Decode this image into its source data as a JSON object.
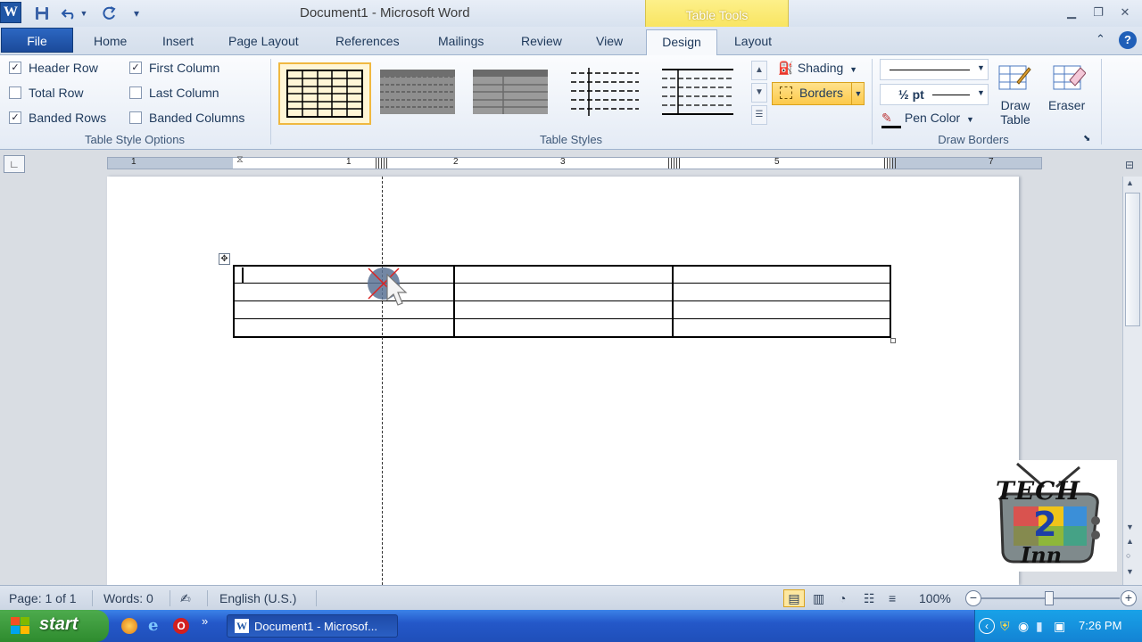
{
  "window": {
    "title": "Document1 - Microsoft Word",
    "contextual_tab_group": "Table Tools"
  },
  "tabs": [
    "File",
    "Home",
    "Insert",
    "Page Layout",
    "References",
    "Mailings",
    "Review",
    "View",
    "Design",
    "Layout"
  ],
  "active_tab": "Design",
  "ribbon": {
    "table_style_options": {
      "label": "Table Style Options",
      "options": [
        {
          "label": "Header Row",
          "checked": true
        },
        {
          "label": "Total Row",
          "checked": false
        },
        {
          "label": "Banded Rows",
          "checked": true
        },
        {
          "label": "First Column",
          "checked": true
        },
        {
          "label": "Last Column",
          "checked": false
        },
        {
          "label": "Banded Columns",
          "checked": false
        }
      ]
    },
    "table_styles": {
      "label": "Table Styles",
      "shading": "Shading",
      "borders": "Borders"
    },
    "draw_borders": {
      "label": "Draw Borders",
      "pen_weight": "½ pt",
      "pen_color": "Pen Color",
      "draw_table": "Draw Table",
      "eraser": "Eraser"
    }
  },
  "ruler": {
    "numbers": [
      "1",
      "1",
      "2",
      "3",
      "5",
      "7"
    ]
  },
  "status_bar": {
    "page": "Page: 1 of 1",
    "words": "Words: 0",
    "language": "English (U.S.)",
    "zoom": "100%"
  },
  "taskbar": {
    "start": "start",
    "window_button": "Document1 - Microsof...",
    "clock": "7:26 PM"
  },
  "logo": {
    "line1": "TECH",
    "line2": "2",
    "line3": "Inn"
  },
  "colors": {
    "file_tab": "#1b4a9a",
    "contextual_tab": "#f8e35c",
    "borders_highlight": "#fcc94b",
    "taskbar": "#2458c9"
  },
  "icons": [
    "word-app-icon",
    "save-icon",
    "undo-icon",
    "redo-icon",
    "customize-qat-icon",
    "minimize-icon",
    "restore-icon",
    "close-icon",
    "help-icon",
    "shading-icon",
    "borders-icon",
    "pen-color-icon",
    "draw-table-icon",
    "eraser-icon",
    "table-move-handle-icon",
    "mouse-cursor-icon"
  ]
}
